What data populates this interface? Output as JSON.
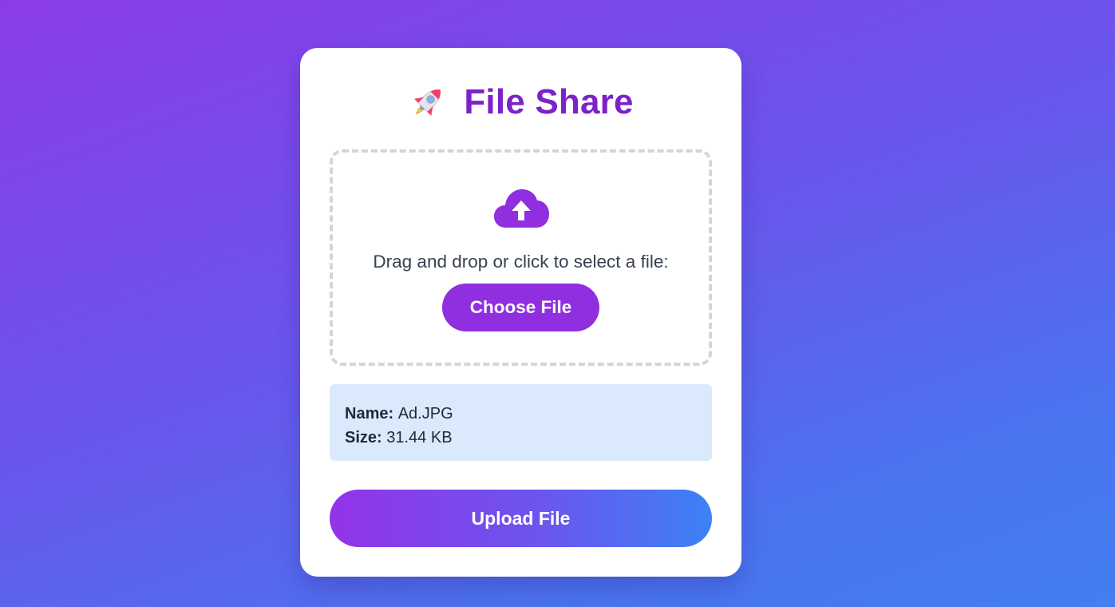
{
  "app": {
    "title": "File Share",
    "title_icon": "rocket-icon"
  },
  "dropzone": {
    "icon": "cloud-upload-icon",
    "instruction": "Drag and drop or click to select a file:",
    "choose_label": "Choose File"
  },
  "file": {
    "name_label": "Name:",
    "name_value": "Ad.JPG",
    "size_label": "Size:",
    "size_value": "31.44 KB"
  },
  "upload": {
    "label": "Upload File"
  },
  "colors": {
    "accent": "#8f2fe0",
    "title": "#7b22c9",
    "info_bg": "#dbe9fd",
    "gradient_start": "#9333ea",
    "gradient_end": "#3b82f6"
  }
}
